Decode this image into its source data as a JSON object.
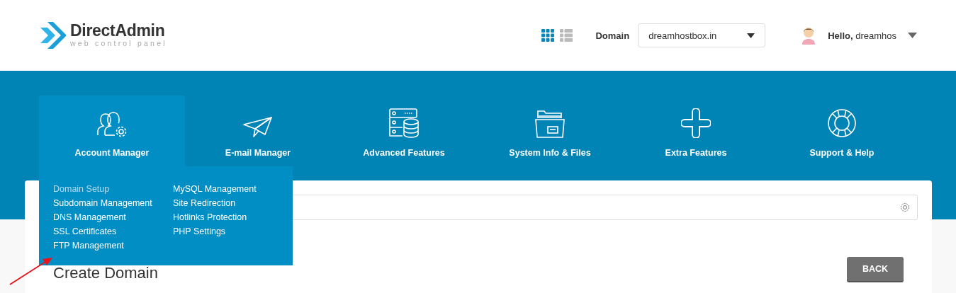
{
  "header": {
    "logo": {
      "name": "DirectAdmin",
      "tagline": "web control panel"
    },
    "view_toggle": [
      {
        "kind": "grid",
        "selected": true
      },
      {
        "kind": "list",
        "selected": false
      }
    ],
    "domain": {
      "label": "Domain",
      "value": "dreamhostbox.in"
    },
    "user": {
      "greeting": "Hello,",
      "name": "dreamhos"
    }
  },
  "nav": [
    {
      "label": "Account Manager",
      "kind": "users",
      "selected": true
    },
    {
      "label": "E-mail Manager",
      "kind": "plane",
      "selected": false
    },
    {
      "label": "Advanced Features",
      "kind": "server",
      "selected": false
    },
    {
      "label": "System Info & Files",
      "kind": "folder",
      "selected": false
    },
    {
      "label": "Extra Features",
      "kind": "plus",
      "selected": false
    },
    {
      "label": "Support & Help",
      "kind": "lifebuoy",
      "selected": false
    }
  ],
  "dropdown": {
    "columns": [
      [
        {
          "label": "Domain Setup",
          "selected": true
        },
        {
          "label": "Subdomain Management",
          "selected": false
        },
        {
          "label": "DNS Management",
          "selected": false
        },
        {
          "label": "SSL Certificates",
          "selected": false
        },
        {
          "label": "FTP Management",
          "selected": false
        }
      ],
      [
        {
          "label": "MySQL Management",
          "selected": false
        },
        {
          "label": "Site Redirection",
          "selected": false
        },
        {
          "label": "Hotlinks Protection",
          "selected": false
        },
        {
          "label": "PHP Settings",
          "selected": false
        }
      ]
    ]
  },
  "page": {
    "title": "Create Domain",
    "back_button": "BACK"
  }
}
